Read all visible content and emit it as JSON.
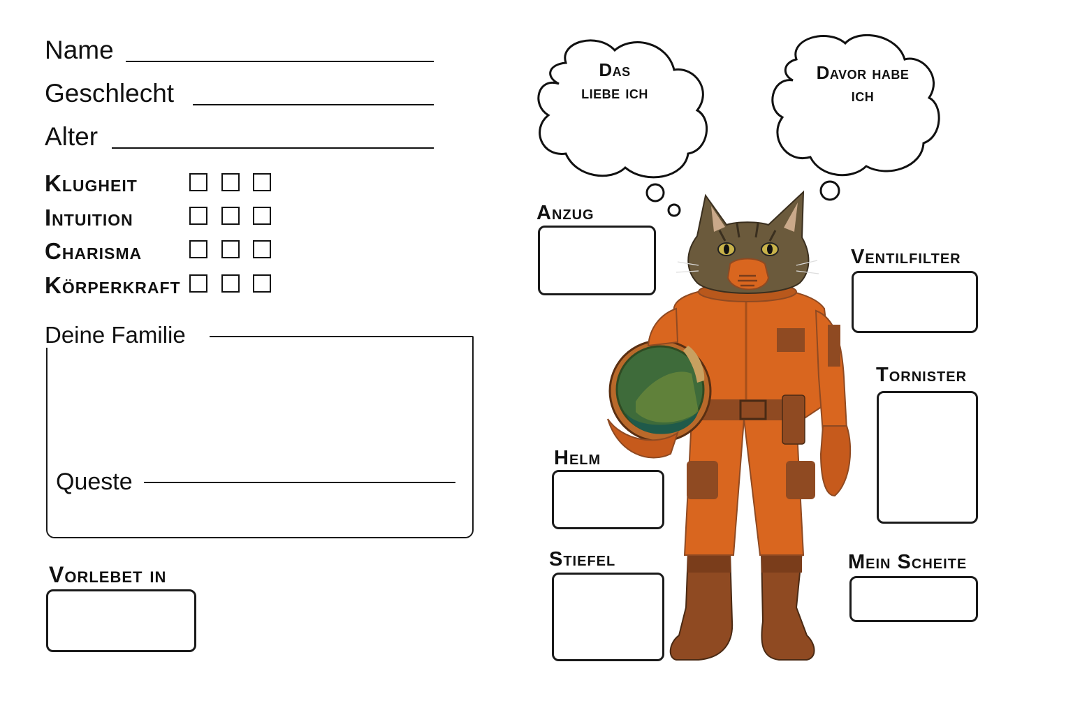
{
  "identity": {
    "name_label": "Name",
    "gender_label": "Geschlecht",
    "age_label": "Alter"
  },
  "attributes": [
    {
      "label": "Klugheit",
      "checked": [
        false,
        false,
        false
      ]
    },
    {
      "label": "Intuition",
      "checked": [
        false,
        false,
        false
      ]
    },
    {
      "label": "Charisma",
      "checked": [
        false,
        false,
        false
      ]
    },
    {
      "label": "Körperkraft",
      "checked": [
        false,
        false,
        false
      ]
    }
  ],
  "family": {
    "label": "Deine Familie",
    "quest_label": "Queste"
  },
  "past": {
    "label": "Vorlebet in"
  },
  "thoughts": {
    "love": {
      "line1": "Das",
      "line2": "liebe ich"
    },
    "fear": {
      "line1": "Davor habe",
      "line2": "ich"
    }
  },
  "gear": {
    "suit": "Anzug",
    "vent_filter": "Ventilfilter",
    "backpack": "Tornister",
    "helmet": "Helm",
    "boots": "Stiefel",
    "log": "Mein Scheite"
  },
  "colors": {
    "suit_orange": "#d9661f",
    "suit_brown": "#8f4a22",
    "cat_fur": "#6b5a3c",
    "visor_green": "#3e6b3a"
  }
}
